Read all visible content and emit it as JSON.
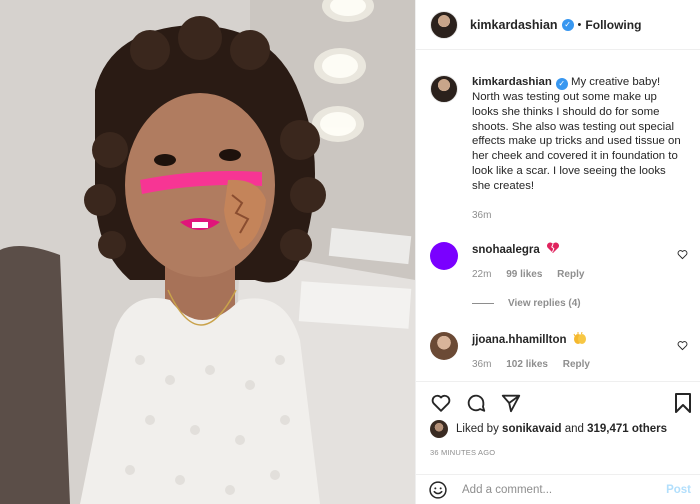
{
  "post": {
    "photo_alt": "",
    "username": "kimkardashian",
    "header_separator": "•",
    "follow_status": "Following",
    "caption": {
      "username": "kimkardashian",
      "text": "My creative baby! North was testing out some make up looks she thinks I should do for some shoots. She also was testing out special effects make up tricks and used tissue on her cheek and covered it in foundation to look like a scar. I love seeing the looks she creates!",
      "time": "36m"
    },
    "comments": [
      {
        "username": "snohaalegra",
        "emoji_icon": "broken-heart-icon",
        "time": "22m",
        "likes": "99 likes",
        "reply": "Reply",
        "avatar_color": "#7a00ff"
      },
      {
        "username": "jjoana.hhamillton",
        "emoji_icon": "clapping-hands-icon",
        "time": "36m",
        "likes": "102 likes",
        "reply": "Reply"
      }
    ],
    "view_replies": "View replies (4)",
    "likes": {
      "prefix": "Liked by",
      "user": "sonikavaid",
      "joiner": "and",
      "count": "319,471 others"
    },
    "time_ago": "36 MINUTES AGO",
    "add_comment": {
      "placeholder": "Add a comment...",
      "post_label": "Post"
    },
    "colors": {
      "accent": "#3897f0",
      "post_disabled": "#b2dffc",
      "muted": "#8e8e8e",
      "text": "#262626"
    }
  }
}
